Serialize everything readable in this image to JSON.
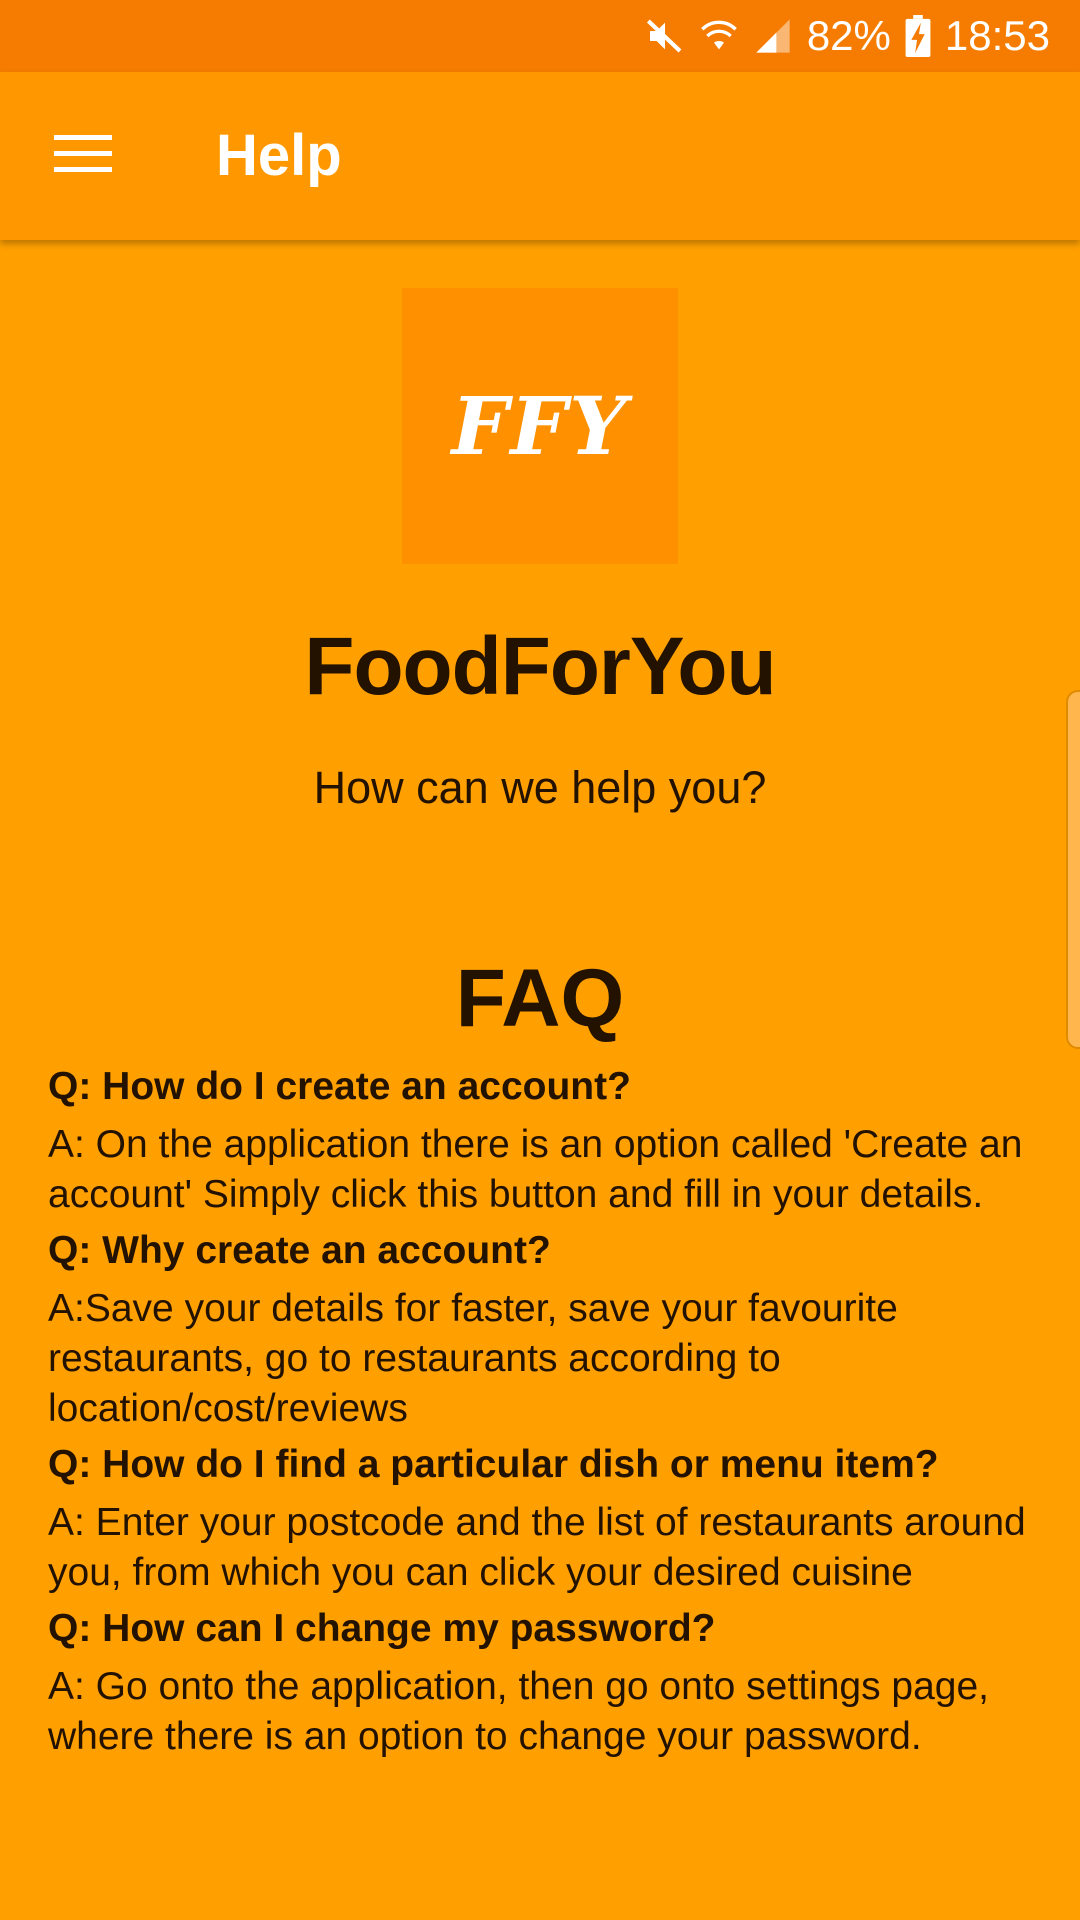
{
  "status_bar": {
    "battery_percent": "82%",
    "time": "18:53",
    "icons": [
      "mute-icon",
      "wifi-icon",
      "signal-icon",
      "battery-charging-icon"
    ]
  },
  "app_bar": {
    "title": "Help",
    "menu_icon": "hamburger-menu-icon"
  },
  "logo": {
    "text": "FFY"
  },
  "brand": {
    "name": "FoodForYou",
    "subtitle": "How can we help you?"
  },
  "faq": {
    "heading": "FAQ",
    "items": [
      {
        "q": "Q: How do I create an account?",
        "a": "A: On the application there is an option called 'Create an account' Simply click this button and fill in your details."
      },
      {
        "q": "Q: Why create an account?",
        "a": "A:Save your details for faster, save your favourite restaurants, go to restaurants according to location/cost/reviews"
      },
      {
        "q": "Q: How do I find a particular dish or menu item?",
        "a": "A: Enter your postcode and the list of restaurants around you, from which you can click your desired cuisine"
      },
      {
        "q": "Q: How can I change my password?",
        "a": "A: Go onto the application, then go onto settings page, where there is an option to change your password."
      }
    ]
  },
  "colors": {
    "status_bar": "#F57C00",
    "app_bar": "#FF9800",
    "background": "#FFA000",
    "logo_box": "#FF9100",
    "text_dark": "#231200"
  }
}
